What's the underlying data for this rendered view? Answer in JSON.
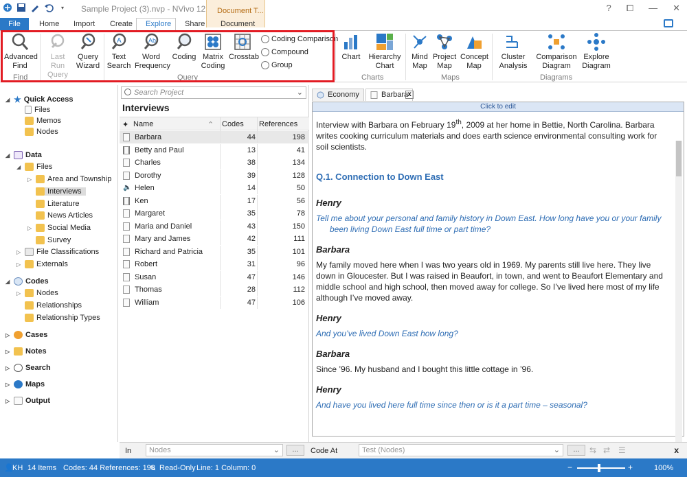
{
  "titlebar": {
    "title": "Sample Project (3).nvp - NVivo 12 Pro",
    "context_group": "Document T...",
    "help": "?",
    "restore": "⧠",
    "minimize": "—",
    "close": "✕"
  },
  "tabs": {
    "file": "File",
    "home": "Home",
    "import": "Import",
    "create": "Create",
    "explore": "Explore",
    "share": "Share",
    "document": "Document"
  },
  "ribbon": {
    "advanced_find": "Advanced Find",
    "last_run_query": "Last Run Query",
    "query_wizard": "Query Wizard",
    "text_search": "Text Search",
    "word_frequency": "Word Frequency",
    "coding": "Coding",
    "matrix_coding": "Matrix Coding",
    "crosstab": "Crosstab",
    "coding_comparison": "Coding Comparison",
    "compound": "Compound",
    "group": "Group",
    "chart": "Chart",
    "hierarchy_chart": "Hierarchy Chart",
    "mind_map": "Mind Map",
    "project_map": "Project Map",
    "concept_map": "Concept Map",
    "cluster_analysis": "Cluster Analysis",
    "comparison_diagram": "Comparison Diagram",
    "explore_diagram": "Explore Diagram",
    "group_find": "Find",
    "group_query": "Query",
    "group_charts": "Charts",
    "group_maps": "Maps",
    "group_diagrams": "Diagrams"
  },
  "nav": {
    "quick_access": "Quick Access",
    "qa_files": "Files",
    "qa_memos": "Memos",
    "qa_nodes": "Nodes",
    "data": "Data",
    "files": "Files",
    "area_township": "Area and Township",
    "interviews": "Interviews",
    "literature": "Literature",
    "news_articles": "News Articles",
    "social_media": "Social Media",
    "survey": "Survey",
    "file_classifications": "File Classifications",
    "externals": "Externals",
    "codes": "Codes",
    "codes_nodes": "Nodes",
    "relationships": "Relationships",
    "relationship_types": "Relationship Types",
    "cases": "Cases",
    "notes": "Notes",
    "search": "Search",
    "maps": "Maps",
    "output": "Output"
  },
  "list": {
    "search_placeholder": "Search Project",
    "title": "Interviews",
    "col_name": "Name",
    "col_codes": "Codes",
    "col_refs": "References",
    "rows": [
      {
        "name": "Barbara",
        "codes": "44",
        "refs": "198"
      },
      {
        "name": "Betty and Paul",
        "codes": "13",
        "refs": "41"
      },
      {
        "name": "Charles",
        "codes": "38",
        "refs": "134"
      },
      {
        "name": "Dorothy",
        "codes": "39",
        "refs": "128"
      },
      {
        "name": "Helen",
        "codes": "14",
        "refs": "50"
      },
      {
        "name": "Ken",
        "codes": "17",
        "refs": "56"
      },
      {
        "name": "Margaret",
        "codes": "35",
        "refs": "78"
      },
      {
        "name": "Maria and Daniel",
        "codes": "43",
        "refs": "150"
      },
      {
        "name": "Mary and James",
        "codes": "42",
        "refs": "111"
      },
      {
        "name": "Richard and Patricia",
        "codes": "35",
        "refs": "101"
      },
      {
        "name": "Robert",
        "codes": "31",
        "refs": "96"
      },
      {
        "name": "Susan",
        "codes": "47",
        "refs": "146"
      },
      {
        "name": "Thomas",
        "codes": "28",
        "refs": "112"
      },
      {
        "name": "William",
        "codes": "47",
        "refs": "106"
      }
    ]
  },
  "detail": {
    "tab_economy": "Economy",
    "tab_barbara": "Barbara",
    "tab_close": "x",
    "click_to_edit": "Click to edit",
    "intro_a": "Interview with Barbara on February 19",
    "intro_sup": "th",
    "intro_b": ", 2009 at her home in Bettie, North Carolina. Barbara writes cooking curriculum materials and does earth science environmental consulting work for soil scientists.",
    "heading": "Q.1. Connection to Down East",
    "speaker1": "Henry",
    "q1": "Tell me about your personal and family history in Down East. How long have you or your family been living Down East full time or part time?",
    "speaker2": "Barbara",
    "a1": "My family moved here when I was two years old in 1969. My parents still live here. They live down in Gloucester. But I was raised in Beaufort, in town, and went to Beaufort Elementary and middle school and high school, then moved away for college. So I’ve lived here most of my life although I’ve moved away.",
    "speaker3": "Henry",
    "q2": "And you’ve lived Down East how long?",
    "speaker4": "Barbara",
    "a2": "Since ’96. My husband and I bought this little cottage in ’96.",
    "speaker5": "Henry",
    "q3": "And have you lived here full time since then or is it a part time – seasonal?"
  },
  "coding_bar": {
    "in_label": "In",
    "in_placeholder": "Nodes",
    "code_at_label": "Code At",
    "code_at_placeholder": "Test (Nodes)",
    "dots": "...",
    "close": "x"
  },
  "status": {
    "user": "KH",
    "items": "14 Items",
    "codes_refs": "Codes: 44  References: 198",
    "read_only": "Read-Only",
    "line_col": "Line: 1  Column: 0",
    "zoom": "100%"
  }
}
